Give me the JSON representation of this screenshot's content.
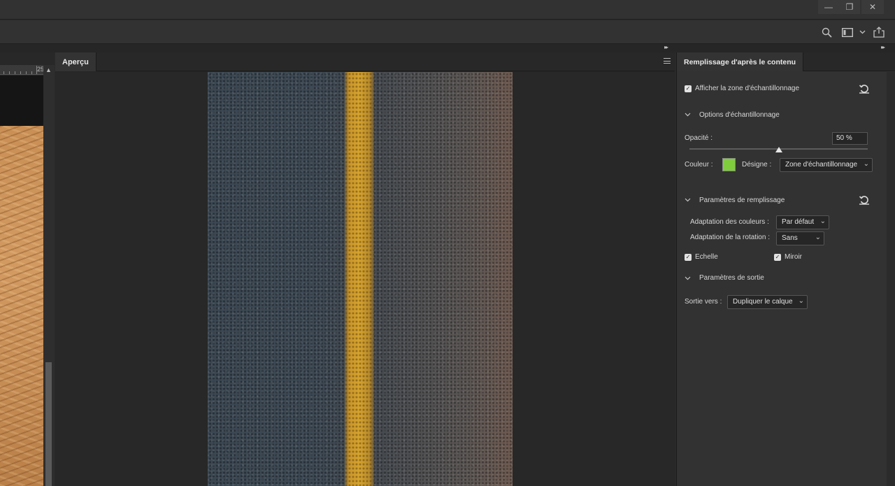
{
  "window": {
    "minimize_glyph": "—",
    "restore_glyph": "❐",
    "close_glyph": "✕"
  },
  "toolbar": {
    "icons": [
      "search-icon",
      "workspace-icon",
      "chevron-down-icon",
      "share-icon"
    ]
  },
  "document_panel": {
    "ruler_label": "25",
    "scroll_up_glyph": "▲"
  },
  "preview_panel": {
    "tab_label": "Aperçu",
    "collapse_glyph": "▸▸"
  },
  "content_aware_panel": {
    "tab_label": "Remplissage d'après le contenu",
    "collapse_glyph": "▸▸",
    "show_sampling_area": {
      "label": "Afficher la zone d'échantillonnage",
      "checked": true
    },
    "sampling_options": {
      "title": "Options d'échantillonnage",
      "opacity_label": "Opacité :",
      "opacity_value": "50 %",
      "opacity_fraction": 0.5,
      "color_label": "Couleur :",
      "color_value": "#7fcc3c",
      "indicates_label": "Désigne :",
      "indicates_value": "Zone d'échantillonnage"
    },
    "fill_settings": {
      "title": "Paramètres de remplissage",
      "color_adaptation_label": "Adaptation des couleurs :",
      "color_adaptation_value": "Par défaut",
      "rotation_adaptation_label": "Adaptation de la rotation :",
      "rotation_adaptation_value": "Sans",
      "scale": {
        "label": "Echelle",
        "checked": true
      },
      "mirror": {
        "label": "Miroir",
        "checked": true
      }
    },
    "output_settings": {
      "title": "Paramètres de sortie",
      "output_to_label": "Sortie vers :",
      "output_to_value": "Dupliquer le calque"
    }
  },
  "glyphs": {
    "check": "✓",
    "caret": "⌄",
    "section_chevron": "⌄"
  }
}
